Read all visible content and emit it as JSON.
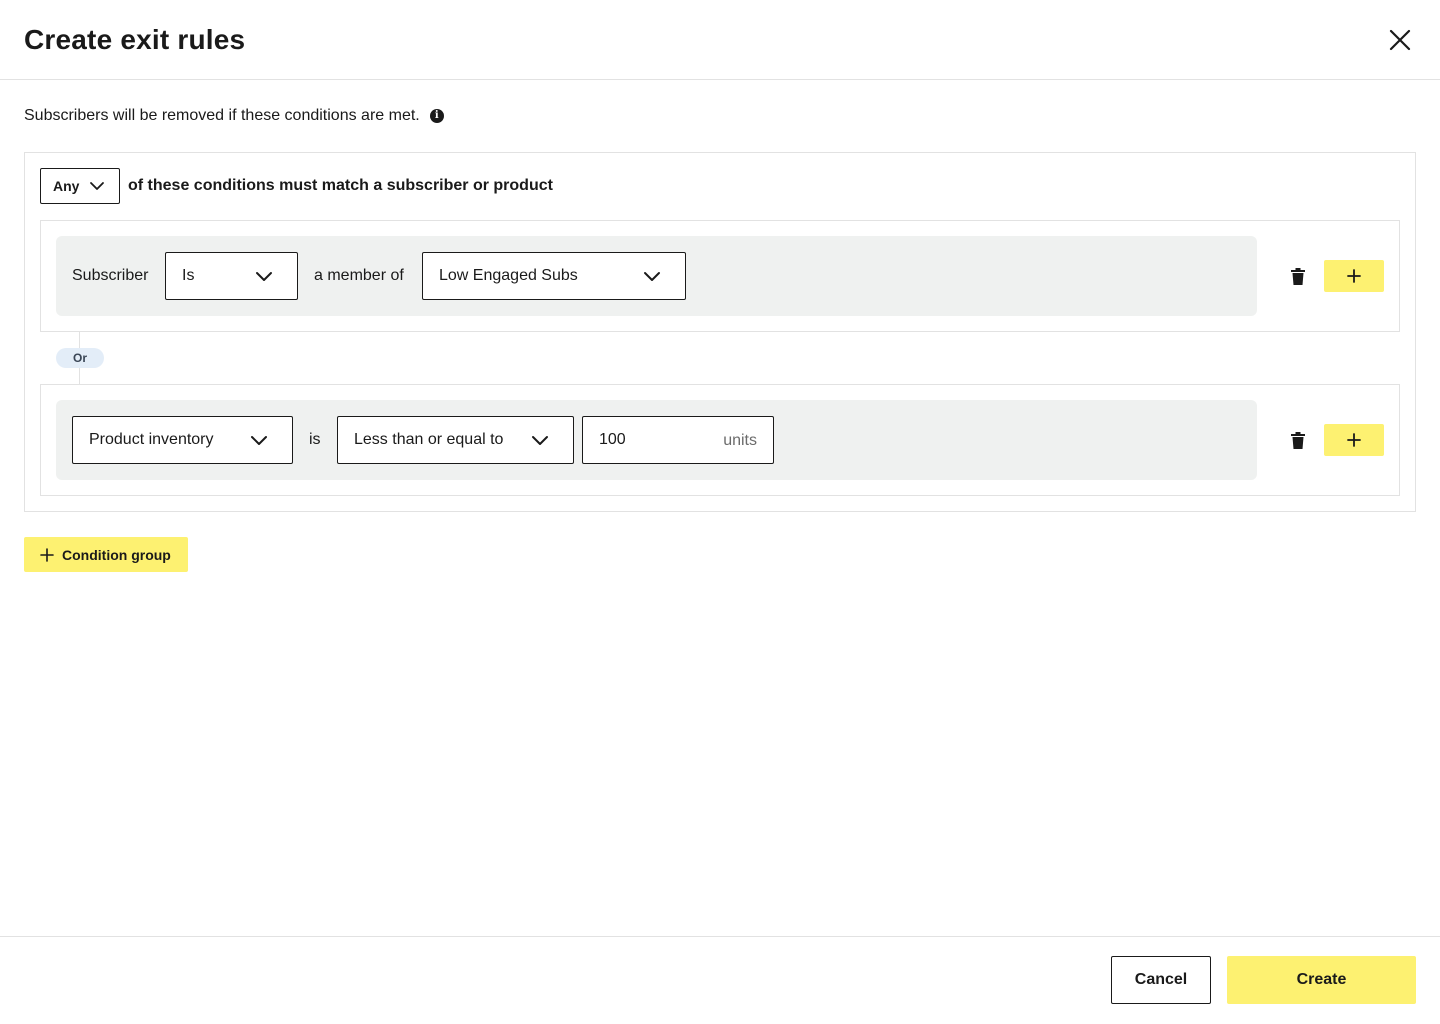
{
  "modal": {
    "title": "Create exit rules",
    "description": "Subscribers will be removed if these conditions are met.",
    "close_icon": "close-icon",
    "info_icon": "info-icon"
  },
  "match": {
    "selected": "Any",
    "text": "of these conditions must match a subscriber or product"
  },
  "groups": [
    {
      "conditions": [
        {
          "subject": "Subscriber",
          "operator": "Is",
          "relation": "a member of",
          "value": "Low Engaged Subs"
        }
      ]
    },
    {
      "conditions": [
        {
          "field": "Product inventory",
          "relation": "is",
          "operator": "Less than or equal to",
          "value": "100",
          "unit": "units"
        }
      ]
    }
  ],
  "connector": "Or",
  "buttons": {
    "add_condition": "+",
    "condition_group": "Condition group",
    "cancel": "Cancel",
    "create": "Create"
  },
  "colors": {
    "accent_yellow": "#fdf171",
    "row_bg": "#eff1f0",
    "or_pill_bg": "#e3edf8",
    "text": "#1a1a1a"
  }
}
